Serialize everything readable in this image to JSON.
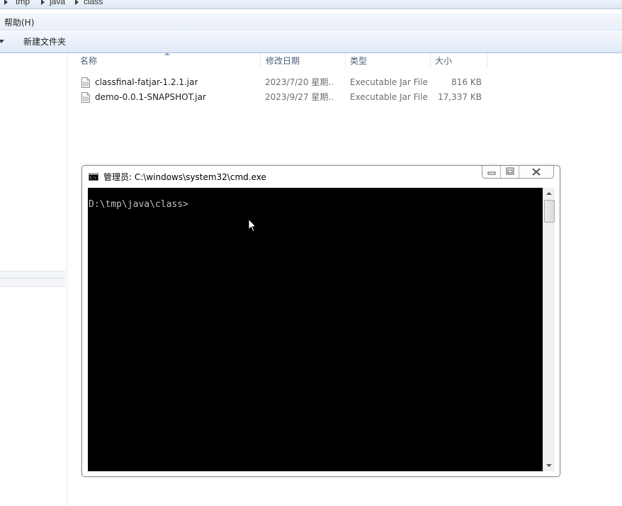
{
  "breadcrumb": [
    "tmp",
    "java",
    "class"
  ],
  "menubar": {
    "help_label": "帮助(H)"
  },
  "toolbar": {
    "new_folder_label": "新建文件夹"
  },
  "columns": {
    "name": "名称",
    "date": "修改日期",
    "type": "类型",
    "size": "大小"
  },
  "files": [
    {
      "name": "classfinal-fatjar-1.2.1.jar",
      "date": "2023/7/20 星期...",
      "type": "Executable Jar File",
      "size": "816 KB"
    },
    {
      "name": "demo-0.0.1-SNAPSHOT.jar",
      "date": "2023/9/27 星期...",
      "type": "Executable Jar File",
      "size": "17,337 KB"
    }
  ],
  "cmd": {
    "title": "管理员: C:\\windows\\system32\\cmd.exe",
    "prompt": "D:\\tmp\\java\\class>"
  },
  "colors": {
    "console_bg": "#000000",
    "console_text": "#c0c0c0",
    "header_text": "#4c607a"
  },
  "icons": {
    "file": "jar-file-icon",
    "cmd": "cmd-window-icon"
  }
}
